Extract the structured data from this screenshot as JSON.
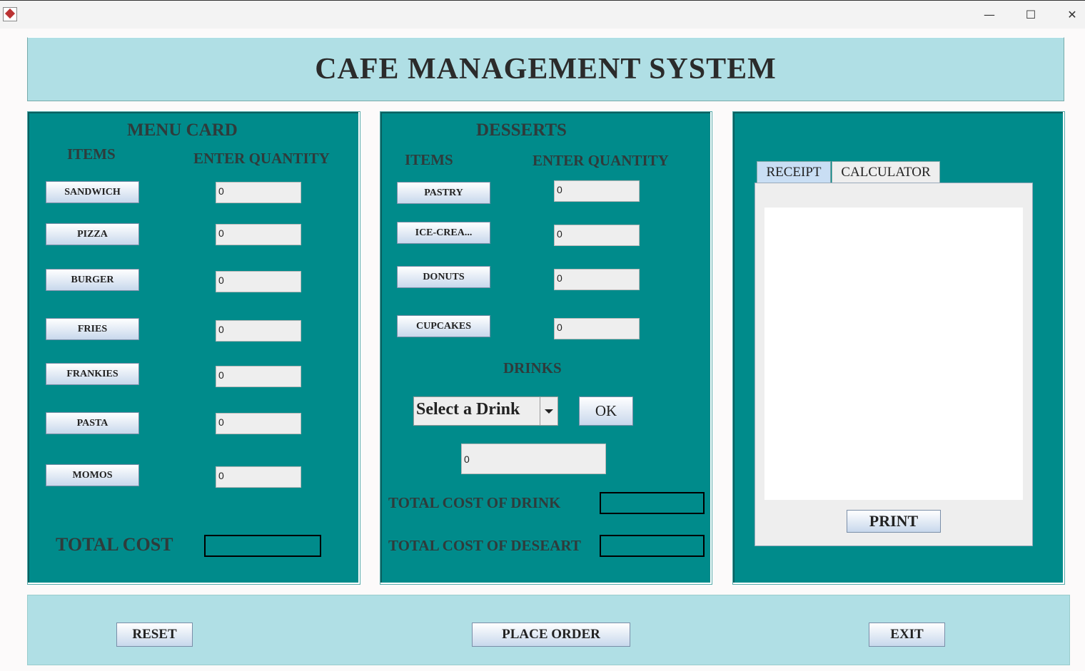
{
  "window": {
    "minimize_glyph": "—",
    "maximize_glyph": "☐",
    "close_glyph": "✕"
  },
  "header": {
    "title": "CAFE MANAGEMENT SYSTEM"
  },
  "menu_card": {
    "title": "MENU CARD",
    "items_label": "ITEMS",
    "qty_label": "ENTER QUANTITY",
    "items": [
      {
        "label": "SANDWICH",
        "qty": "0"
      },
      {
        "label": "PIZZA",
        "qty": "0"
      },
      {
        "label": "BURGER",
        "qty": "0"
      },
      {
        "label": "FRIES",
        "qty": "0"
      },
      {
        "label": "FRANKIES",
        "qty": "0"
      },
      {
        "label": "PASTA",
        "qty": "0"
      },
      {
        "label": "MOMOS",
        "qty": "0"
      }
    ],
    "total_cost_label": "TOTAL COST",
    "total_cost_value": ""
  },
  "desserts": {
    "title": "DESSERTS",
    "items_label": "ITEMS",
    "qty_label": "ENTER QUANTITY",
    "items": [
      {
        "label": "PASTRY",
        "qty": "0"
      },
      {
        "label": "ICE-CREA...",
        "qty": "0"
      },
      {
        "label": "DONUTS",
        "qty": "0"
      },
      {
        "label": "CUPCAKES",
        "qty": "0"
      }
    ]
  },
  "drinks": {
    "title": "DRINKS",
    "select_value": "Select a Drink",
    "ok_label": "OK",
    "qty": "0",
    "total_drink_label": "TOTAL COST OF DRINK",
    "total_drink_value": "",
    "total_dessert_label": "TOTAL COST OF DESEART",
    "total_dessert_value": ""
  },
  "receipt_panel": {
    "tabs": [
      "RECEIPT",
      "CALCULATOR"
    ],
    "active_tab": "RECEIPT",
    "receipt_text": "",
    "print_label": "PRINT"
  },
  "footer": {
    "reset_label": "RESET",
    "place_order_label": "PLACE ORDER",
    "exit_label": "EXIT"
  }
}
